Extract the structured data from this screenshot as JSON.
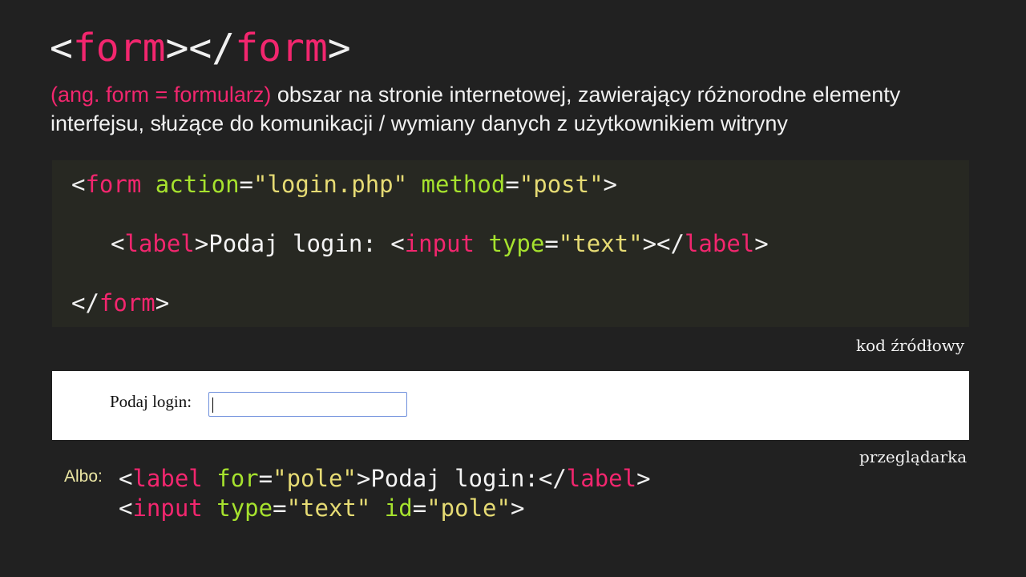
{
  "title": {
    "open_bracket": "<",
    "tag_open": "form",
    "close_open": "></",
    "tag_close": "form",
    "close_bracket": ">"
  },
  "description": {
    "accent": "(ang. form = formularz)",
    "text": " obszar na stronie internetowej, zawierający różnorodne elementy interfejsu, służące do komunikacji / wymiany danych z użytkownikiem witryny"
  },
  "code_example": {
    "line1": {
      "lt": "<",
      "tag": "form",
      "sp1": " ",
      "attr1": "action",
      "eq1": "=",
      "val1": "\"login.php\"",
      "sp2": " ",
      "attr2": "method",
      "eq2": "=",
      "val2": "\"post\"",
      "gt": ">"
    },
    "line2": {
      "lt1": "<",
      "tag1": "label",
      "gt1": ">",
      "text": "Podaj login: ",
      "lt2": "<",
      "tag2": "input",
      "sp": " ",
      "attr": "type",
      "eq": "=",
      "val": "\"text\"",
      "gt2": "></",
      "tag3": "label",
      "gt3": ">"
    },
    "line3": {
      "lt": "</",
      "tag": "form",
      "gt": ">"
    },
    "caption": "kod źródłowy"
  },
  "browser_preview": {
    "label": "Podaj login:",
    "input_value": "",
    "caption": "przeglądarka"
  },
  "alternative": {
    "label": "Albo:",
    "line1": {
      "lt1": "<",
      "tag1": "label",
      "sp": " ",
      "attr": "for",
      "eq": "=",
      "val": "\"pole\"",
      "gt1": ">",
      "text": "Podaj login:",
      "lt2": "</",
      "tag2": "label",
      "gt2": ">"
    },
    "line2": {
      "lt": "<",
      "tag": "input",
      "sp1": " ",
      "attr1": "type",
      "eq1": "=",
      "val1": "\"text\"",
      "sp2": " ",
      "attr2": "id",
      "eq2": "=",
      "val2": "\"pole\"",
      "gt": ">"
    }
  },
  "colors": {
    "background": "#212121",
    "code_background": "#272822",
    "tag_name": "#f2266e",
    "attribute": "#a6e22e",
    "string": "#e6db74",
    "albo": "#ece7a4"
  }
}
